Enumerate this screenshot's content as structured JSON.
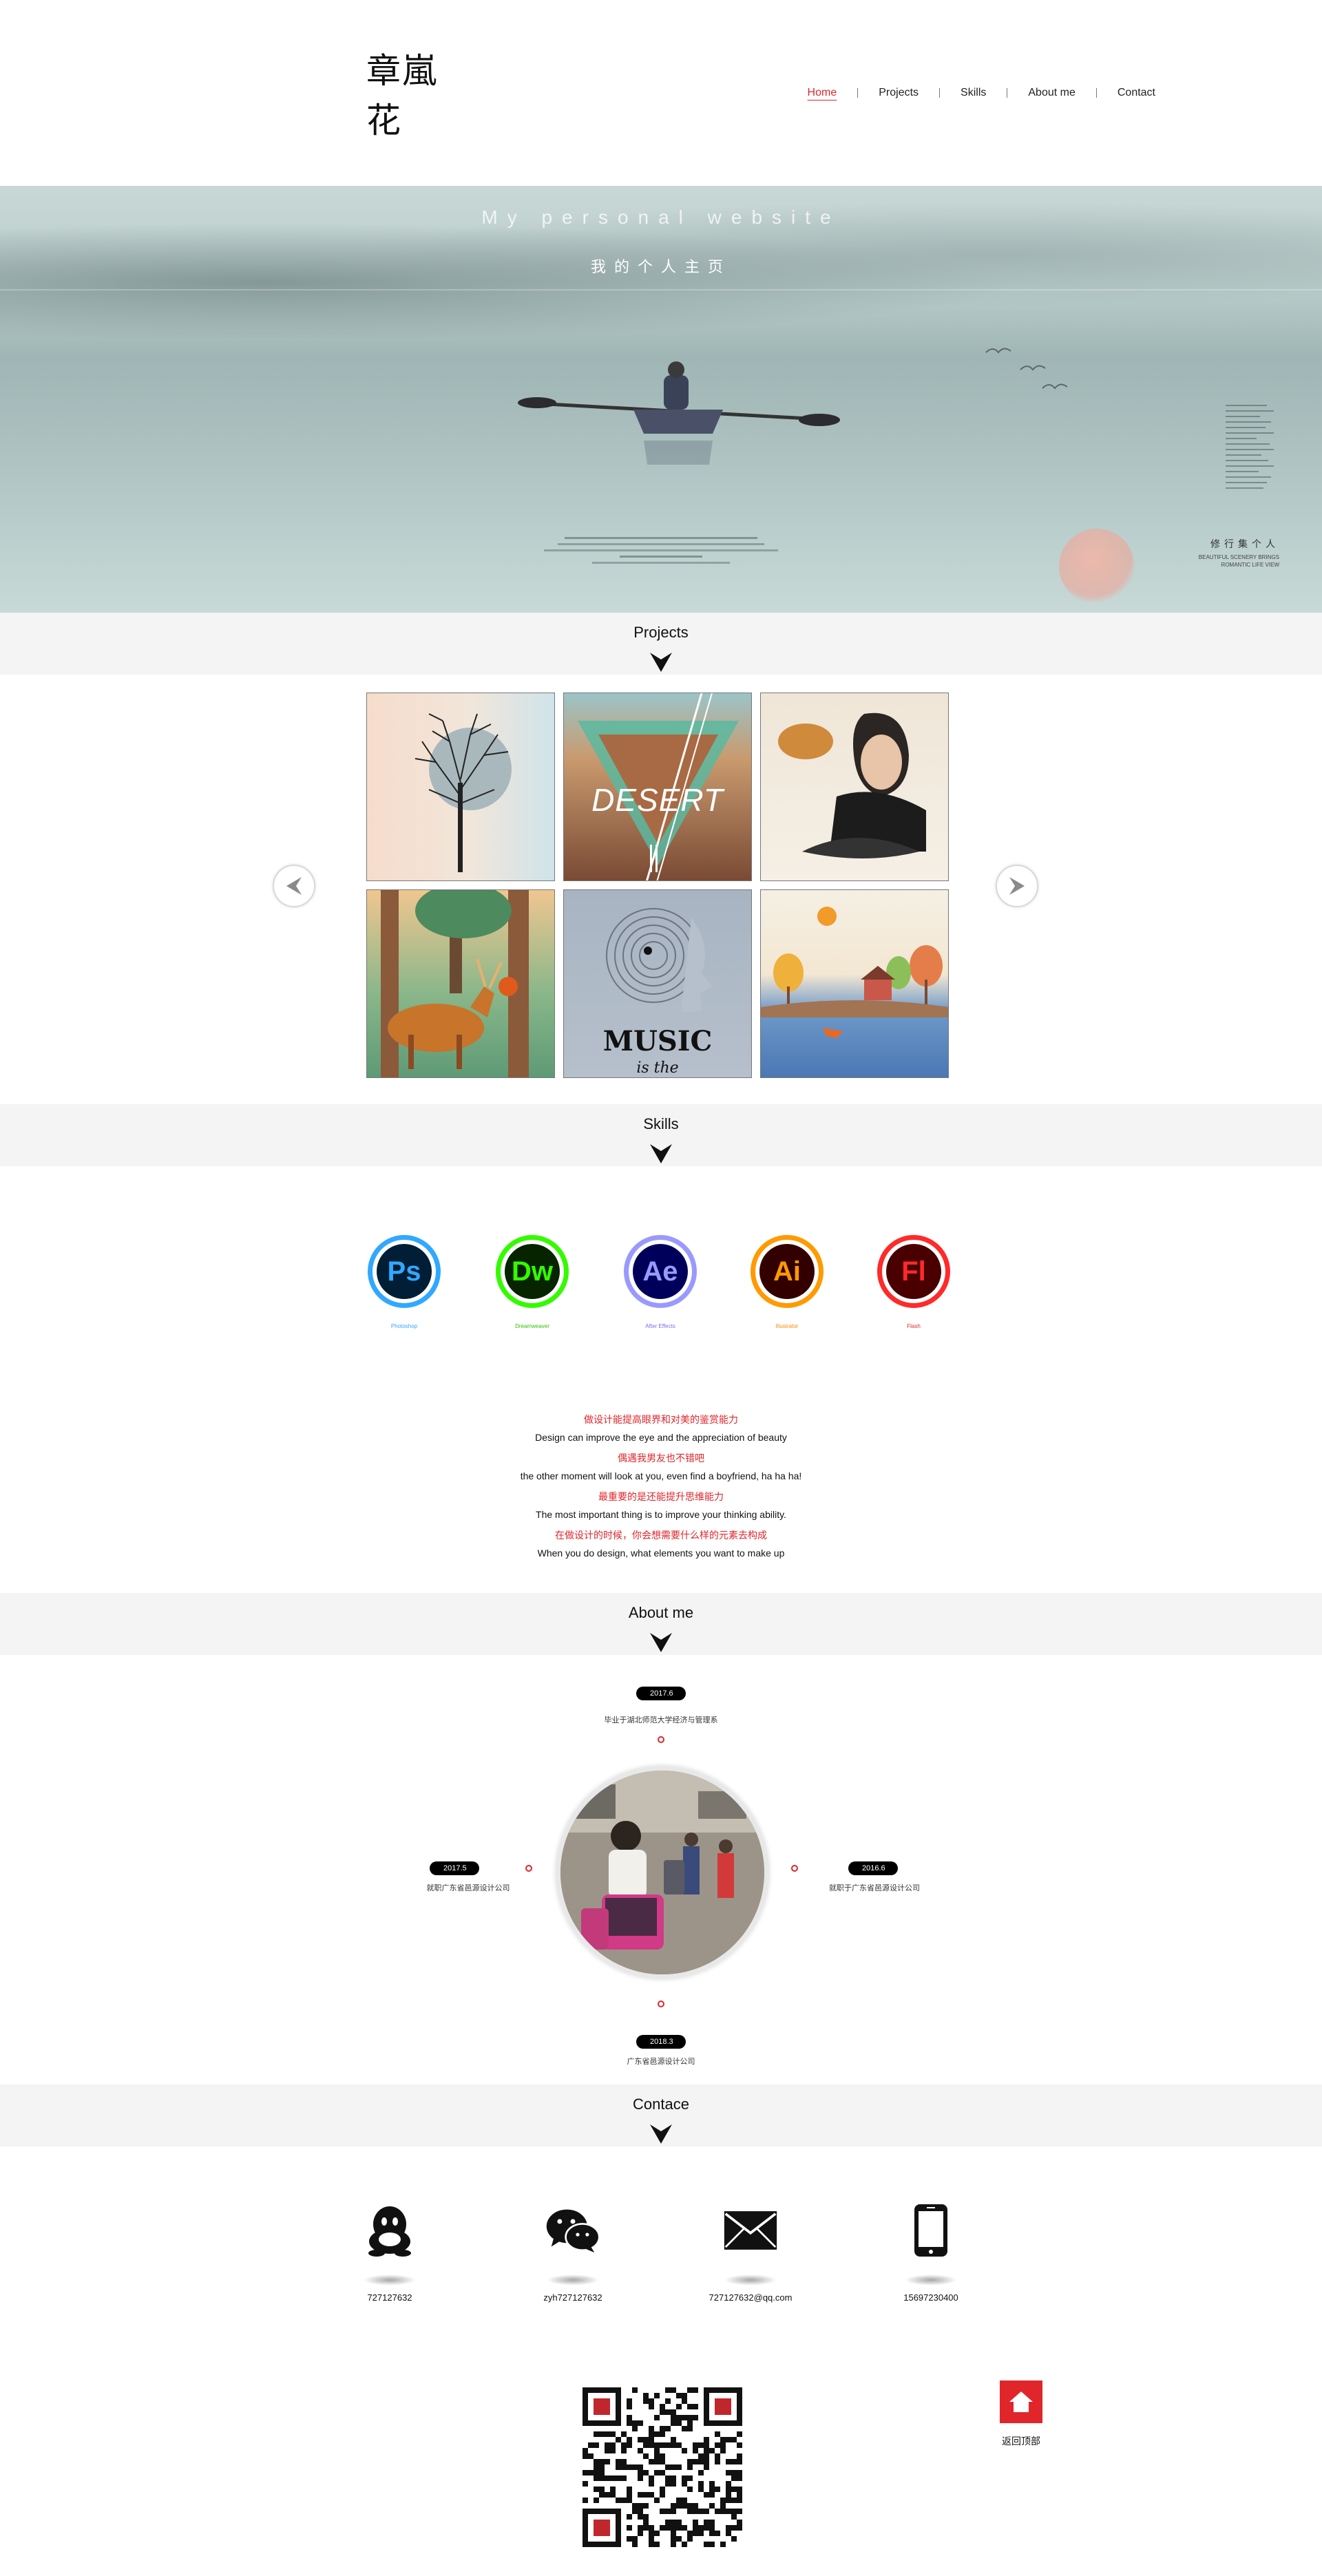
{
  "header": {
    "logo_text": "章嵐花",
    "nav": [
      {
        "label": "Home",
        "active": true
      },
      {
        "label": "Projects",
        "active": false
      },
      {
        "label": "Skills",
        "active": false
      },
      {
        "label": "About me",
        "active": false
      },
      {
        "label": "Contact",
        "active": false
      }
    ]
  },
  "hero": {
    "title": "My personal website",
    "subtitle": "我的个人主页",
    "tagline": "修行集个人",
    "tagline_small": "BEAUTIFUL SCENERY BRINGS\nROMANTIC LIFE VIEW"
  },
  "projects": {
    "section_title": "Projects",
    "tiles": [
      {
        "name": "tree",
        "caption": ""
      },
      {
        "name": "desert",
        "caption": "DESERT"
      },
      {
        "name": "portrait",
        "caption": ""
      },
      {
        "name": "deer",
        "caption": ""
      },
      {
        "name": "music",
        "caption": "MUSIC",
        "caption2": "is the"
      },
      {
        "name": "village",
        "caption": ""
      }
    ]
  },
  "skills": {
    "section_title": "Skills",
    "items": [
      {
        "abbr": "Ps",
        "name": "Photoshop",
        "color": "#31a8ff",
        "bg": "#001e36"
      },
      {
        "abbr": "Dw",
        "name": "Dreamweaver",
        "color": "#35fa00",
        "bg": "#072401"
      },
      {
        "abbr": "Ae",
        "name": "After Effects",
        "color": "#9999ff",
        "bg": "#00005b"
      },
      {
        "abbr": "Ai",
        "name": "Illustrator",
        "color": "#ff9a00",
        "bg": "#330000"
      },
      {
        "abbr": "Fl",
        "name": "Flash",
        "color": "#ff2a2a",
        "bg": "#4a0000"
      }
    ],
    "quotes": [
      {
        "lang": "cn",
        "text": "做设计能提高眼界和对美的鉴赏能力"
      },
      {
        "lang": "en",
        "text": "Design can improve the eye and the appreciation of beauty"
      },
      {
        "lang": "cn",
        "text": "偶遇我男友也不错吧"
      },
      {
        "lang": "en",
        "text": "the other moment will look at you, even find a boyfriend, ha ha ha!"
      },
      {
        "lang": "cn",
        "text": "最重要的是还能提升思维能力"
      },
      {
        "lang": "en",
        "text": "The most important thing is to improve your thinking ability."
      },
      {
        "lang": "cn",
        "text": "在做设计的时候，你会想需要什么样的元素去构成"
      },
      {
        "lang": "en",
        "text": "When you do design, what elements you want to make up"
      }
    ]
  },
  "about": {
    "section_title": "About me",
    "timeline": [
      {
        "date": "2017.6",
        "text": "毕业于湖北师范大学经济与管理系"
      },
      {
        "date": "2017.5",
        "text": "就职广东省邑源设计公司"
      },
      {
        "date": "2016.6",
        "text": "就职于广东省邑源设计公司"
      },
      {
        "date": "2018.3",
        "text": "广东省邑源设计公司"
      }
    ]
  },
  "contact": {
    "section_title": "Contace",
    "items": [
      {
        "icon": "qq-icon",
        "value": "727127632"
      },
      {
        "icon": "wechat-icon",
        "value": "zyh727127632"
      },
      {
        "icon": "mail-icon",
        "value": "727127632@qq.com"
      },
      {
        "icon": "phone-icon",
        "value": "15697230400"
      }
    ],
    "back_to_top": "返回顶部"
  },
  "colors": {
    "accent": "#e0252b",
    "section_bg": "#f4f4f4"
  }
}
